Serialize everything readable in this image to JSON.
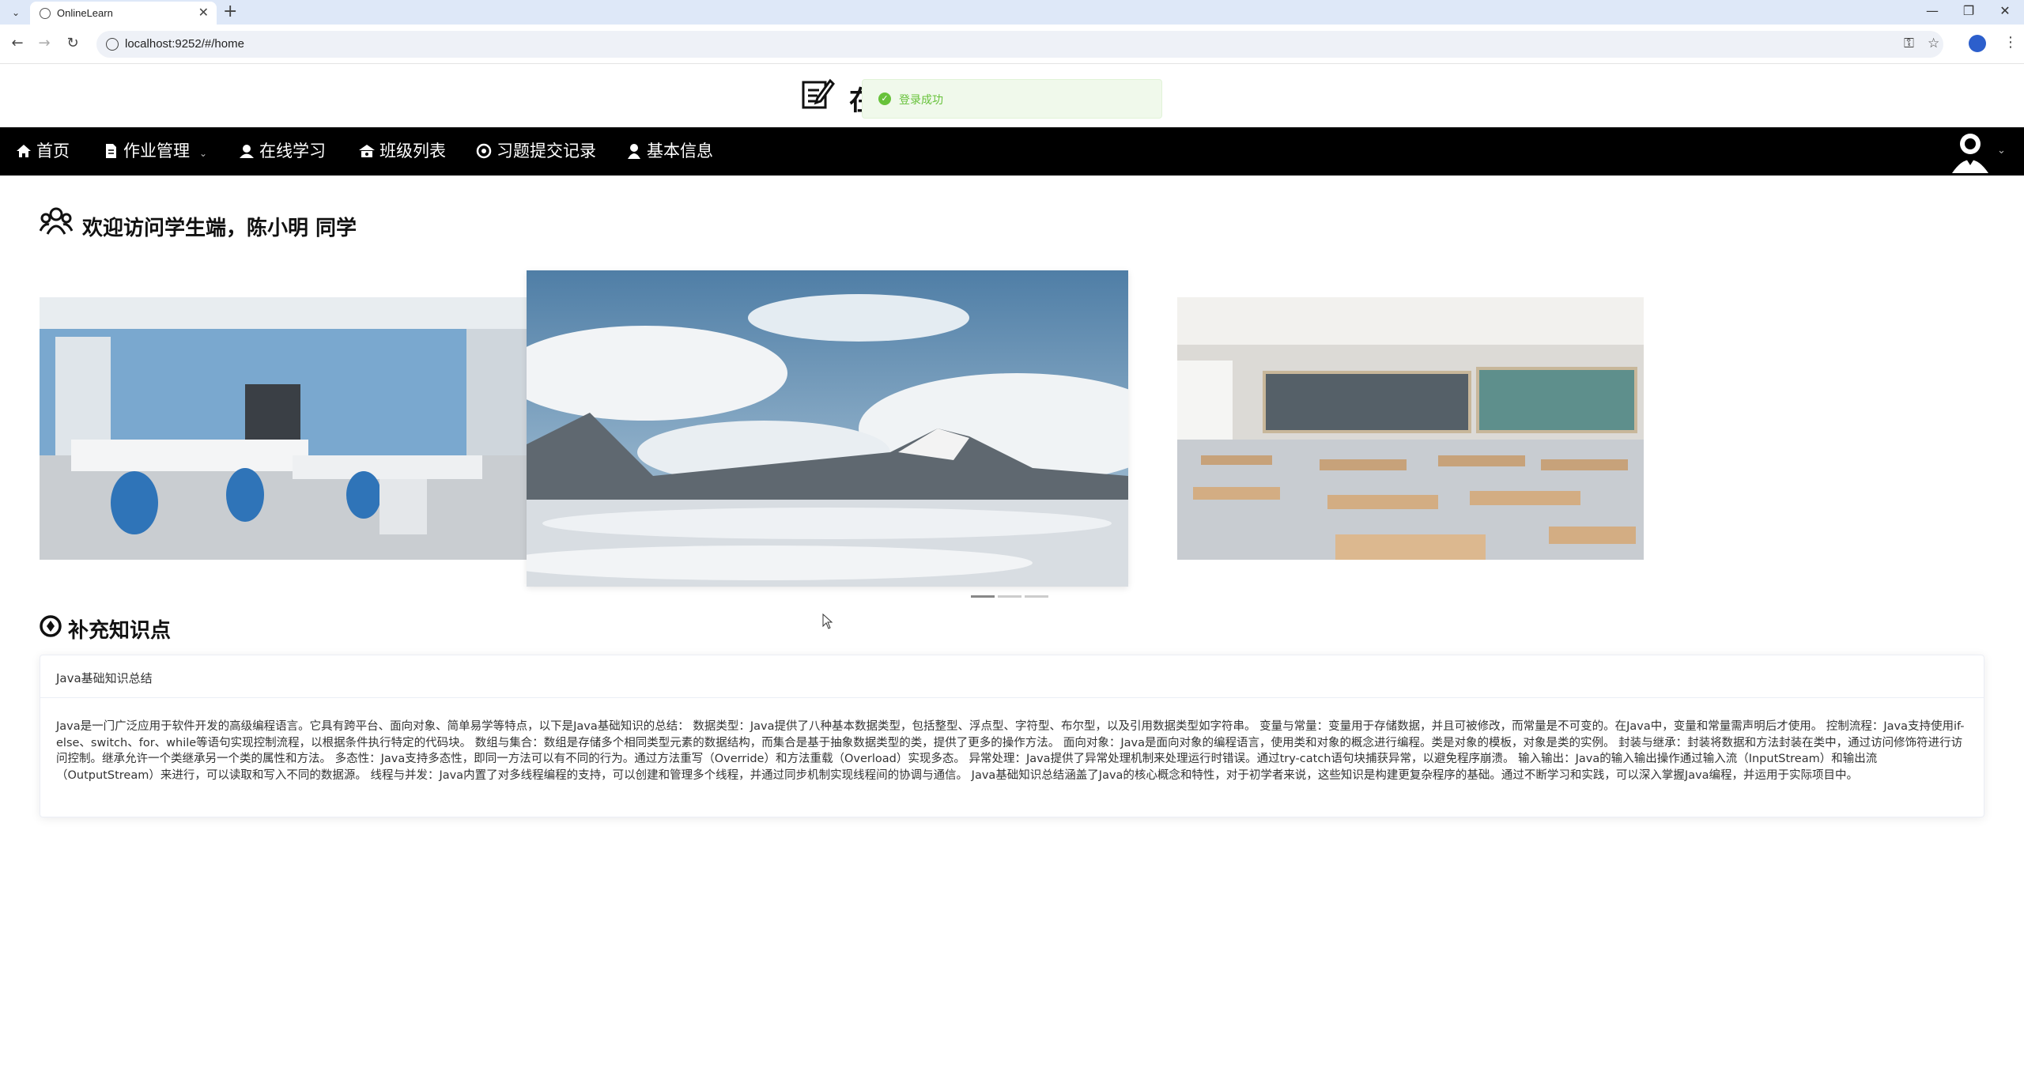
{
  "browser": {
    "tab_title": "OnlineLearn",
    "url": "localhost:9252/#/home",
    "new_tab_symbol": "+",
    "close_symbol": "✕"
  },
  "header": {
    "logo_char": "在",
    "toast_message": "登录成功"
  },
  "nav": {
    "items": [
      {
        "label": "首页",
        "icon": "home-icon"
      },
      {
        "label": "作业管理",
        "icon": "document-icon"
      },
      {
        "label": "在线学习",
        "icon": "learn-icon"
      },
      {
        "label": "班级列表",
        "icon": "class-icon"
      },
      {
        "label": "习题提交记录",
        "icon": "record-icon"
      },
      {
        "label": "基本信息",
        "icon": "user-icon"
      }
    ]
  },
  "welcome": {
    "text": "欢迎访问学生端，陈小明 同学"
  },
  "carousel": {
    "slides": [
      "office",
      "sky",
      "classroom"
    ],
    "active_index": 0
  },
  "section": {
    "title": "补充知识点"
  },
  "card": {
    "title": "Java基础知识总结",
    "body": "Java是一门广泛应用于软件开发的高级编程语言。它具有跨平台、面向对象、简单易学等特点，以下是Java基础知识的总结： 数据类型：Java提供了八种基本数据类型，包括整型、浮点型、字符型、布尔型，以及引用数据类型如字符串。 变量与常量：变量用于存储数据，并且可被修改，而常量是不可变的。在Java中，变量和常量需声明后才使用。 控制流程：Java支持使用if-else、switch、for、while等语句实现控制流程，以根据条件执行特定的代码块。 数组与集合：数组是存储多个相同类型元素的数据结构，而集合是基于抽象数据类型的类，提供了更多的操作方法。 面向对象：Java是面向对象的编程语言，使用类和对象的概念进行编程。类是对象的模板，对象是类的实例。 封装与继承：封装将数据和方法封装在类中，通过访问修饰符进行访问控制。继承允许一个类继承另一个类的属性和方法。 多态性：Java支持多态性，即同一方法可以有不同的行为。通过方法重写（Override）和方法重载（Overload）实现多态。 异常处理：Java提供了异常处理机制来处理运行时错误。通过try-catch语句块捕获异常，以避免程序崩溃。 输入输出：Java的输入输出操作通过输入流（InputStream）和输出流（OutputStream）来进行，可以读取和写入不同的数据源。 线程与并发：Java内置了对多线程编程的支持，可以创建和管理多个线程，并通过同步机制实现线程间的协调与通信。 Java基础知识总结涵盖了Java的核心概念和特性，对于初学者来说，这些知识是构建更复杂程序的基础。通过不断学习和实践，可以深入掌握Java编程，并运用于实际项目中。"
  }
}
